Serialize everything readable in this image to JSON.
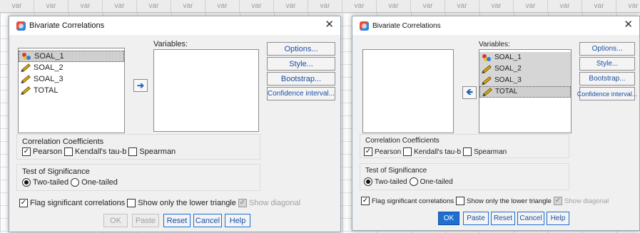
{
  "sheet": {
    "column_header": "var",
    "columns": 19
  },
  "left_dialog": {
    "title": "Bivariate Correlations",
    "source_variables": [
      "SOAL_1",
      "SOAL_2",
      "SOAL_3",
      "TOTAL"
    ],
    "variables_label": "Variables:",
    "buttons": {
      "options": "Options...",
      "style": "Style...",
      "bootstrap": "Bootstrap...",
      "confidence": "Confidence interval..."
    },
    "correlation_coefficients": {
      "title": "Correlation Coefficients",
      "pearson": "Pearson",
      "kendall": "Kendall's tau-b",
      "spearman": "Spearman"
    },
    "significance": {
      "title": "Test of Significance",
      "two_tailed": "Two-tailed",
      "one_tailed": "One-tailed"
    },
    "flag_label": "Flag significant correlations",
    "lower_label": "Show only the lower triangle",
    "diag_label": "Show diagonal",
    "footer": {
      "ok": "OK",
      "paste": "Paste",
      "reset": "Reset",
      "cancel": "Cancel",
      "help": "Help"
    }
  },
  "right_dialog": {
    "title": "Bivariate Correlations",
    "variables_label": "Variables:",
    "target_variables": [
      "SOAL_1",
      "SOAL_2",
      "SOAL_3",
      "TOTAL"
    ],
    "buttons": {
      "options": "Options...",
      "style": "Style...",
      "bootstrap": "Bootstrap...",
      "confidence": "Confidence interval..."
    },
    "correlation_coefficients": {
      "title": "Correlation Coefficients",
      "pearson": "Pearson",
      "kendall": "Kendall's tau-b",
      "spearman": "Spearman"
    },
    "significance": {
      "title": "Test of Significance",
      "two_tailed": "Two-tailed",
      "one_tailed": "One-tailed"
    },
    "flag_label": "Flag significant correlations",
    "lower_label": "Show only the lower triangle",
    "diag_label": "Show diagonal",
    "footer": {
      "ok": "OK",
      "paste": "Paste",
      "reset": "Reset",
      "cancel": "Cancel",
      "help": "Help"
    }
  }
}
